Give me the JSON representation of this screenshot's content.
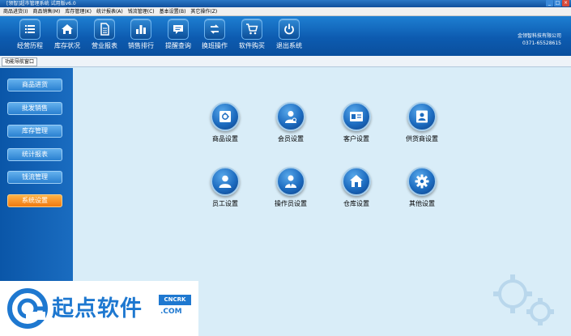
{
  "window": {
    "title": "[领智]超市管理系统 试用版v6.0",
    "controls": [
      "_",
      "□",
      "×"
    ]
  },
  "menu": [
    "商品进货(I)",
    "商品销售(M)",
    "库存管理(K)",
    "统计报表(A)",
    "钱流管理(C)",
    "基本设置(B)",
    "其它操作(Z)"
  ],
  "toolbar": {
    "items": [
      {
        "label": "经营历程",
        "icon": "list-icon"
      },
      {
        "label": "库存状况",
        "icon": "home-icon"
      },
      {
        "label": "营业报表",
        "icon": "document-icon"
      },
      {
        "label": "销售排行",
        "icon": "bar-chart-icon"
      },
      {
        "label": "提醒查询",
        "icon": "message-icon"
      },
      {
        "label": "换班操作",
        "icon": "switch-icon"
      },
      {
        "label": "软件购买",
        "icon": "cart-icon"
      },
      {
        "label": "退出系统",
        "icon": "power-icon"
      }
    ],
    "company_name": "金领智科技有限公司",
    "company_phone": "0371-65528615"
  },
  "nav_tab": "功能导航窗口",
  "sidebar": {
    "items": [
      {
        "label": "商品进货",
        "active": false
      },
      {
        "label": "批发销售",
        "active": false
      },
      {
        "label": "库存管理",
        "active": false
      },
      {
        "label": "统计报表",
        "active": false
      },
      {
        "label": "钱流管理",
        "active": false
      },
      {
        "label": "系统设置",
        "active": true
      }
    ]
  },
  "features": [
    {
      "label": "商品设置",
      "icon": "safe-icon"
    },
    {
      "label": "会员设置",
      "icon": "member-icon"
    },
    {
      "label": "客户设置",
      "icon": "id-card-icon"
    },
    {
      "label": "供货商设置",
      "icon": "supplier-icon"
    },
    {
      "label": "员工设置",
      "icon": "user-icon"
    },
    {
      "label": "操作员设置",
      "icon": "operator-icon"
    },
    {
      "label": "仓库设置",
      "icon": "warehouse-icon"
    },
    {
      "label": "其他设置",
      "icon": "gear-icon"
    }
  ],
  "watermark": {
    "text": "起点软件",
    "badge": "CNCRK",
    "domain": ".COM"
  },
  "colors": {
    "toolbar": "#0d5bb0",
    "sidebar": "#0a56a8",
    "sidebar_button": "#3a8fd8",
    "active_button": "#f07a10",
    "main_bg": "#d9edf8",
    "watermark_blue": "#1e78d0"
  }
}
